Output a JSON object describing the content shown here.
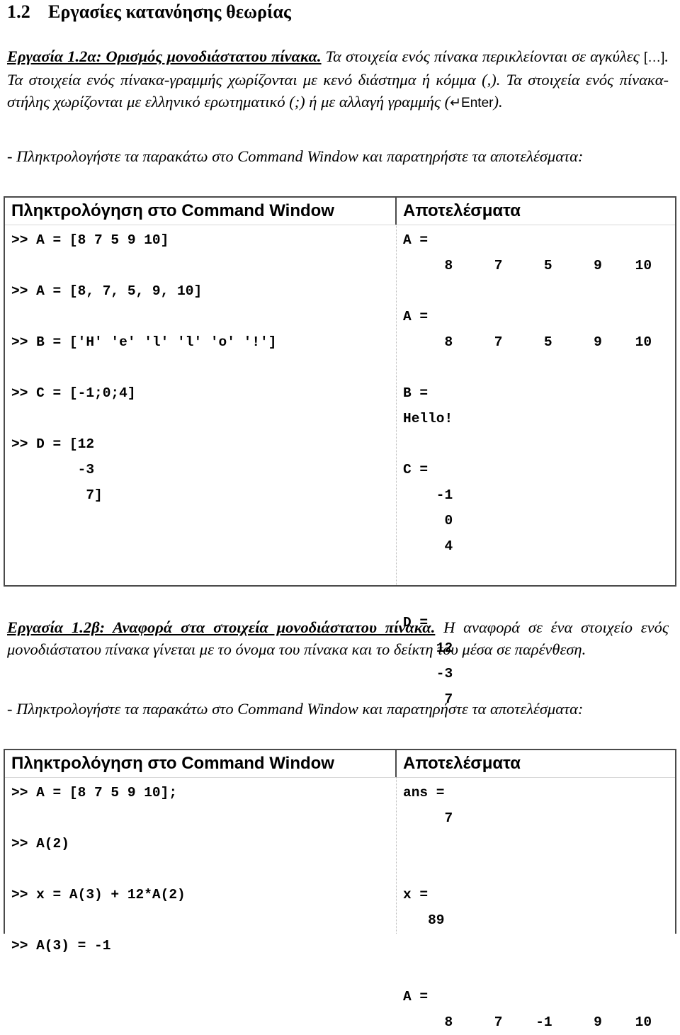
{
  "heading": {
    "number": "1.2",
    "title": "Εργασίες κατανόησης θεωρίας"
  },
  "exercise_a": {
    "label": "Εργασία 1.2α: Ορισμός μονοδιάστατου πίνακα.",
    "body_1": " Τα στοιχεία ενός πίνακα περικλείονται σε αγκύλες ",
    "brackets": "[…]",
    "body_2": ". Τα στοιχεία ενός πίνακα-γραμμής χωρίζονται με κενό διάστημα ή κόμμα (,). Τα στοιχεία ενός πίνακα-στήλης χωρίζονται με ελληνικό ερωτηματικό (;) ή με αλλαγή γραμμής (",
    "enter_key": "↵Enter",
    "body_3": ")."
  },
  "prompt_1": "- Πληκτρολογήστε τα παρακάτω στο Command Window και παρατηρήστε τα αποτελέσματα:",
  "table_1": {
    "header_left": "Πληκτρολόγηση στο Command Window",
    "header_right": "Αποτελέσματα",
    "left_lines": [
      ">> A = [8 7 5 9 10]",
      "",
      ">> A = [8, 7, 5, 9, 10]",
      "",
      ">> B = ['H' 'e' 'l' 'l' 'o' '!']",
      "",
      ">> C = [-1;0;4]",
      "",
      ">> D = [12",
      "        -3",
      "         7]"
    ],
    "right_lines": [
      "A =",
      "     8     7     5     9    10",
      "",
      "A =",
      "     8     7     5     9    10",
      "",
      "B =",
      "Hello!",
      "",
      "C =",
      "    -1",
      "     0",
      "     4",
      "",
      "",
      "D =",
      "    12",
      "    -3",
      "     7"
    ]
  },
  "exercise_b": {
    "label": "Εργασία 1.2β: Αναφορά στα στοιχεία μονοδιάστατου πίνακα.",
    "body": " Η αναφορά σε ένα στοιχείο ενός μονοδιάστατου πίνακα γίνεται με το όνομα του πίνακα και το δείκτη του μέσα σε παρένθεση."
  },
  "prompt_2": "- Πληκτρολογήστε τα παρακάτω στο Command Window και παρατηρήστε τα αποτελέσματα:",
  "table_2": {
    "header_left": "Πληκτρολόγηση στο Command Window",
    "header_right": "Αποτελέσματα",
    "left_lines": [
      ">> A = [8 7 5 9 10];",
      "",
      ">> A(2)",
      "",
      ">> x = A(3) + 12*A(2)",
      "",
      ">> A(3) = -1"
    ],
    "right_lines": [
      "ans =",
      "     7",
      "",
      "",
      "x =",
      "   89",
      "",
      "",
      "A =",
      "     8     7    -1     9    10"
    ]
  }
}
